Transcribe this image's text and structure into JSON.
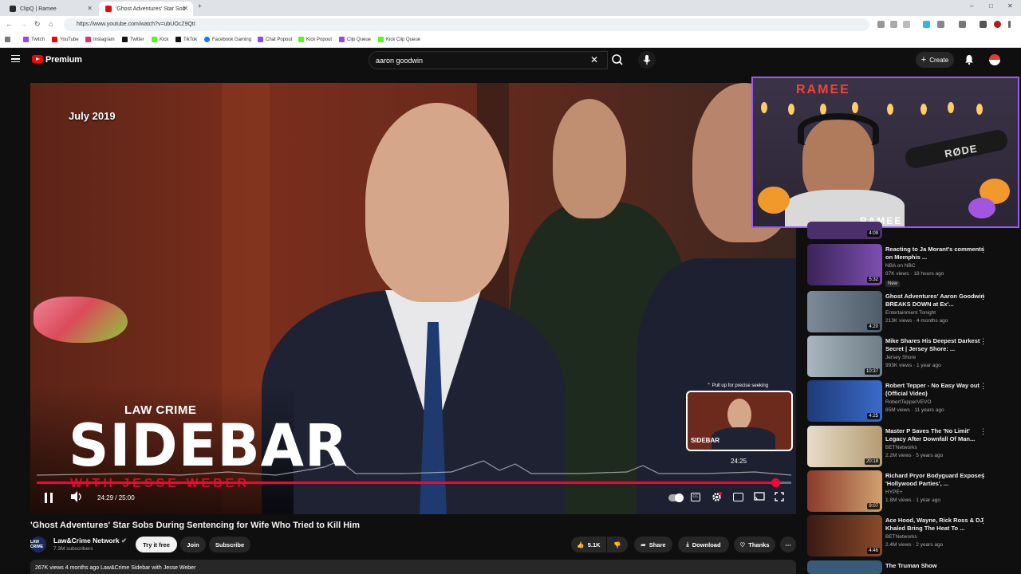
{
  "browser": {
    "tabs": [
      {
        "label": "ClipQ | Ramee",
        "active": false,
        "color": "#2b2b2b"
      },
      {
        "label": "'Ghost Adventures' Star Sob",
        "active": true,
        "color": "#ff0000"
      }
    ],
    "new_tab": "+",
    "window_controls": [
      "–",
      "□",
      "✕"
    ],
    "nav": {
      "back": "←",
      "forward": "→",
      "reload": "↻",
      "home": "⌂"
    },
    "url": "https://www.youtube.com/watch?v=ubUOcZ9QtI",
    "bookmarks": [
      {
        "label": "Twitch",
        "color": "#9146ff"
      },
      {
        "label": "YouTube",
        "color": "#ff0000"
      },
      {
        "label": "Instagram",
        "color": "#e1306c"
      },
      {
        "label": "Twitter",
        "color": "#111111"
      },
      {
        "label": "Kick",
        "color": "#53fc18"
      },
      {
        "label": "TikTok",
        "color": "#111111"
      },
      {
        "label": "Facebook Gaming",
        "color": "#1877f2"
      },
      {
        "label": "Chat Popout",
        "color": "#9146ff"
      },
      {
        "label": "Kick Popout",
        "color": "#53fc18"
      },
      {
        "label": "Clip Queue",
        "color": "#9146ff"
      },
      {
        "label": "Kick Clip Queue",
        "color": "#53fc18"
      }
    ]
  },
  "youtube": {
    "brand": "Premium",
    "search": {
      "value": "aaron goodwin",
      "clear": "✕"
    },
    "create_label": "Create",
    "bell_icon": "🔔"
  },
  "player": {
    "date_overlay": "July 2019",
    "lower_third": {
      "network": "LAW  CRIME",
      "show": "SIDEBAR",
      "host": "WITH JESSE WEBER"
    },
    "preview_hint": "⌃ Pull up for precise seeking",
    "preview_time": "24:25",
    "preview_label": "SIDEBAR",
    "timecode": "24:29 / 25:00",
    "progress_fraction": 0.979
  },
  "webcam": {
    "name_top": "RAMEE",
    "name_bottom": "RAMEE",
    "mic_brand": "RØDE"
  },
  "recommendations": [
    {
      "title": "",
      "channel": "",
      "meta": "",
      "duration": "4:09",
      "thumb_color": "#4a2f6b",
      "partial": true
    },
    {
      "title": "Reacting to Ja Morant's comments on Memphis ...",
      "channel": "NBA on NBC",
      "meta": "97K views · 18 hours ago",
      "duration": "5:32",
      "thumb_color": "#5d3a8a",
      "badge": "New"
    },
    {
      "title": "Ghost Adventures' Aaron Goodwin BREAKS DOWN at Ex'...",
      "channel": "Entertainment Tonight",
      "meta": "213K views · 4 months ago",
      "duration": "4:20",
      "thumb_color": "#6d7b8a"
    },
    {
      "title": "Mike Shares His Deepest Darkest Secret | Jersey Shore: ...",
      "channel": "Jersey Shore",
      "meta": "993K views · 1 year ago",
      "duration": "10:37",
      "thumb_color": "#8fa0aa"
    },
    {
      "title": "Robert Tepper - No Easy Way out (Official Video)",
      "channel": "RobertTepperVEVO",
      "meta": "85M views · 11 years ago",
      "duration": "4:25",
      "thumb_color": "#2c4a8c"
    },
    {
      "title": "Master P Saves The 'No Limit' Legacy After Downfall Of Man...",
      "channel": "BETNetworks",
      "meta": "2.2M views · 5 years ago",
      "duration": "20:18",
      "thumb_color": "#c9b79a"
    },
    {
      "title": "Richard Pryor Bodyguard Exposes 'Hollywood Parties', ...",
      "channel": "HYPE+",
      "meta": "1.8M views · 1 year ago",
      "duration": "9:07",
      "thumb_color": "#7a3b2e"
    },
    {
      "title": "Ace Hood, Wayne, Rick Ross & DJ Khaled Bring The Heat To ...",
      "channel": "BETNetworks",
      "meta": "2.4M views · 2 years ago",
      "duration": "4:46",
      "thumb_color": "#5a2a1f"
    },
    {
      "title": "The Truman Show",
      "channel": "",
      "meta": "",
      "duration": "",
      "thumb_color": "#3a5a7a",
      "partial": true
    }
  ],
  "video": {
    "title": "'Ghost Adventures' Star Sobs During Sentencing for Wife Who Tried to Kill Him",
    "channel": "Law&Crime Network",
    "channel_avatar": "LAW CRIME",
    "subscribers": "7.3M subscribers",
    "try_free": "Try it free",
    "join": "Join",
    "subscribe": "Subscribe",
    "likes": "5.1K",
    "share": "Share",
    "download": "Download",
    "thanks": "Thanks",
    "more": "⋯",
    "description": "267K views  4 months ago  Law&Crime Sidebar with Jesse Weber"
  }
}
